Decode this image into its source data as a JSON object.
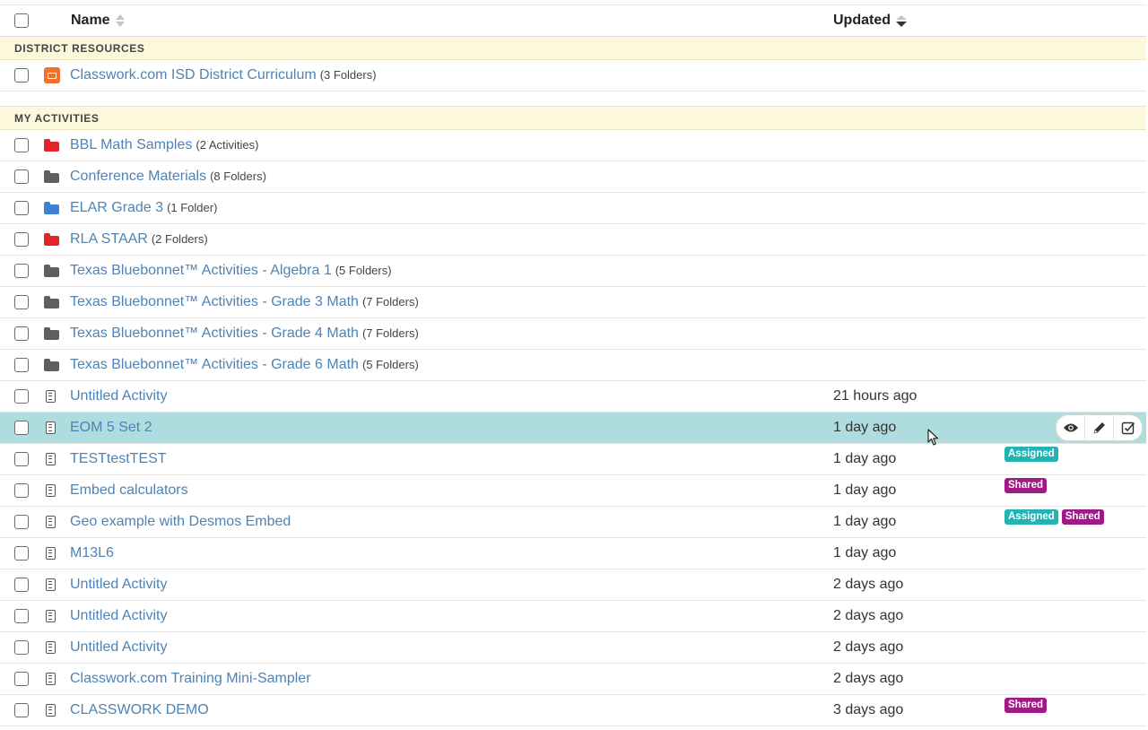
{
  "header": {
    "name_label": "Name",
    "updated_label": "Updated"
  },
  "sections": {
    "district": "DISTRICT RESOURCES",
    "mine": "MY ACTIVITIES"
  },
  "district_items": [
    {
      "name": "Classwork.com ISD District Curriculum",
      "count": "(3 Folders)"
    }
  ],
  "folders": [
    {
      "name": "BBL Math Samples",
      "count": "(2 Activities)",
      "color": "#e5232b"
    },
    {
      "name": "Conference Materials",
      "count": "(8 Folders)",
      "color": "#5f5f5f"
    },
    {
      "name": "ELAR Grade 3",
      "count": "(1 Folder)",
      "color": "#3c83d6"
    },
    {
      "name": "RLA STAAR",
      "count": "(2 Folders)",
      "color": "#e5232b"
    },
    {
      "name": "Texas Bluebonnet™ Activities - Algebra 1",
      "count": "(5 Folders)",
      "color": "#5f5f5f"
    },
    {
      "name": "Texas Bluebonnet™ Activities - Grade 3 Math",
      "count": "(7 Folders)",
      "color": "#5f5f5f"
    },
    {
      "name": "Texas Bluebonnet™ Activities - Grade 4 Math",
      "count": "(7 Folders)",
      "color": "#5f5f5f"
    },
    {
      "name": "Texas Bluebonnet™ Activities - Grade 6 Math",
      "count": "(5 Folders)",
      "color": "#5f5f5f"
    }
  ],
  "activities": [
    {
      "name": "Untitled Activity",
      "updated": "21 hours ago"
    },
    {
      "name": "EOM 5 Set 2",
      "updated": "1 day ago"
    },
    {
      "name": "TESTtestTEST",
      "updated": "1 day ago",
      "badges": [
        "Assigned"
      ]
    },
    {
      "name": "Embed calculators",
      "updated": "1 day ago",
      "badges": [
        "Shared"
      ]
    },
    {
      "name": "Geo example with Desmos Embed",
      "updated": "1 day ago",
      "badges": [
        "Assigned",
        "Shared"
      ]
    },
    {
      "name": "M13L6",
      "updated": "1 day ago"
    },
    {
      "name": "Untitled Activity",
      "updated": "2 days ago"
    },
    {
      "name": "Untitled Activity",
      "updated": "2 days ago"
    },
    {
      "name": "Untitled Activity",
      "updated": "2 days ago"
    },
    {
      "name": "Classwork.com Training Mini-Sampler",
      "updated": "2 days ago"
    },
    {
      "name": "CLASSWORK DEMO",
      "updated": "3 days ago",
      "badges": [
        "Shared"
      ]
    }
  ],
  "hover_actions": [
    "eye-icon",
    "pencil-icon",
    "assign-check-icon"
  ],
  "colors": {
    "link": "#4e83b3",
    "highlight": "#afdcde",
    "section_bg": "#fcf8dc",
    "assigned": "#22b3b3",
    "shared": "#a01a87"
  }
}
